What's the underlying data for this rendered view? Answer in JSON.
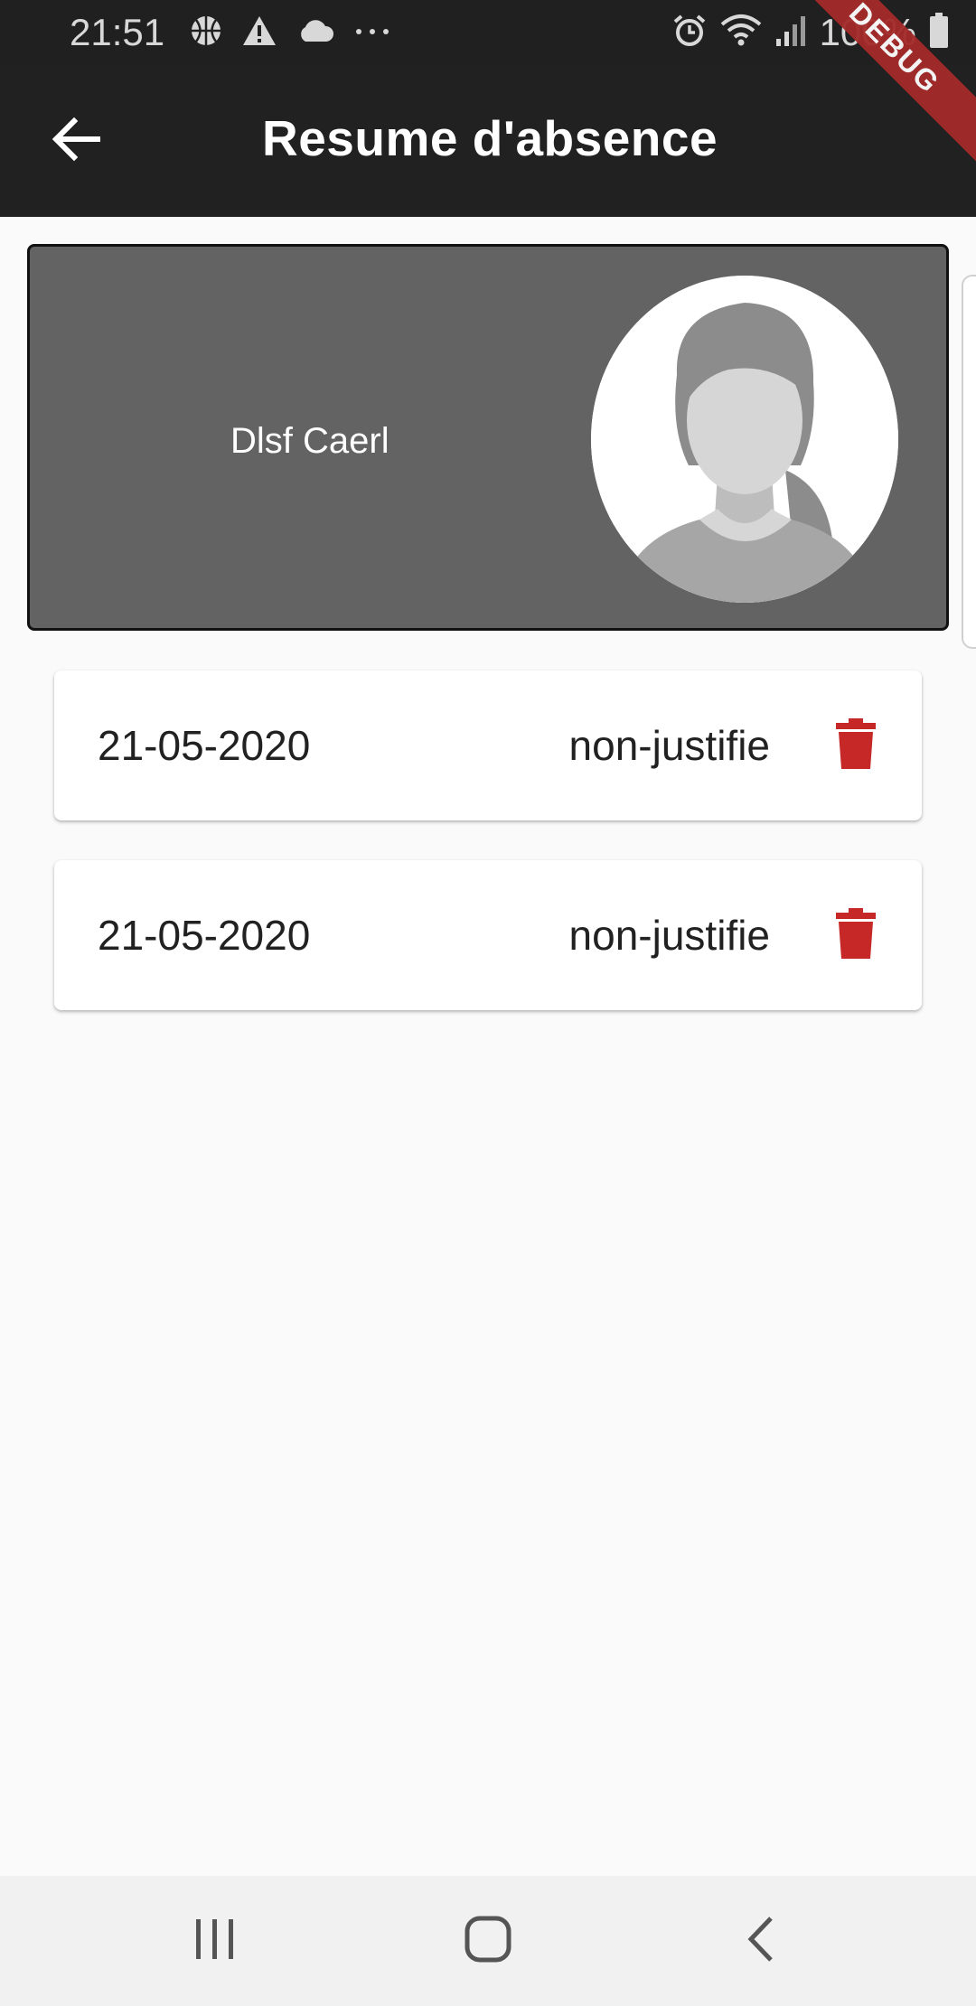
{
  "status_bar": {
    "time": "21:51",
    "left_icons": [
      "basketball-icon",
      "warning-icon",
      "cloud-icon",
      "more-icon"
    ],
    "right_icons": [
      "alarm-icon",
      "wifi-icon",
      "signal-icon",
      "battery-icon"
    ],
    "battery": "100%"
  },
  "debug_banner": "DEBUG",
  "app_bar": {
    "title": "Resume d'absence",
    "back_icon": "arrow-back-icon"
  },
  "profile": {
    "name": "Dlsf Caerl",
    "avatar_icon": "female-avatar-placeholder"
  },
  "absences": [
    {
      "date": "21-05-2020",
      "status": "non-justifie",
      "delete_icon": "trash-icon"
    },
    {
      "date": "21-05-2020",
      "status": "non-justifie",
      "delete_icon": "trash-icon"
    }
  ],
  "nav_bar": {
    "buttons": [
      "recent-apps-icon",
      "home-icon",
      "back-icon"
    ]
  },
  "colors": {
    "app_bar": "#212121",
    "status_bar": "#202020",
    "profile_card": "#636363",
    "delete_red": "#c62828",
    "debug_ribbon": "#a52a2a",
    "background": "#fafafa"
  }
}
